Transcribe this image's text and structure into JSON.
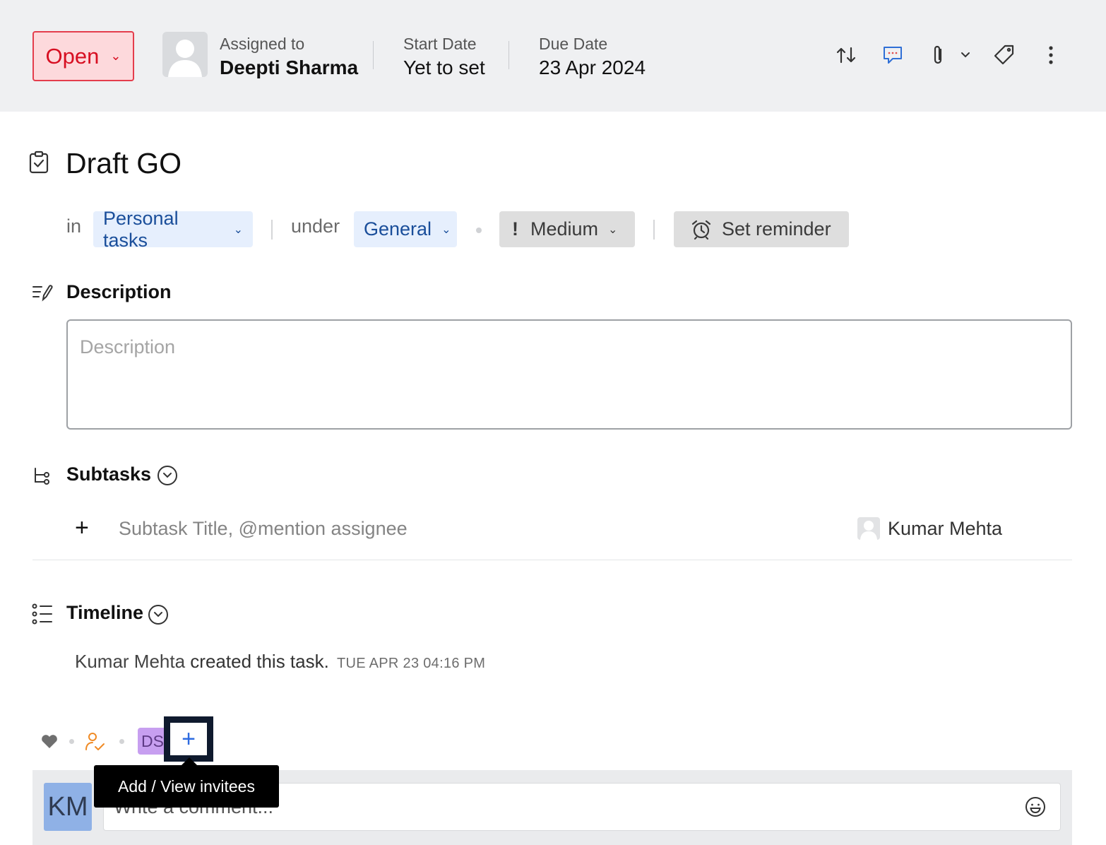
{
  "header": {
    "status_label": "Open",
    "assigned_label": "Assigned to",
    "assigned_name": "Deepti Sharma",
    "start_label": "Start Date",
    "start_value": "Yet to set",
    "due_label": "Due Date",
    "due_value": "23 Apr 2024",
    "icons": [
      "switch-icon",
      "comment-icon",
      "attachment-icon",
      "chevron-down-icon",
      "tag-icon",
      "more-icon"
    ],
    "colors": {
      "status_bg": "#fdd9dc",
      "status_border": "#e43d4c",
      "status_text": "#d70f22",
      "header_bg": "#eff0f2"
    }
  },
  "task": {
    "title": "Draft GO",
    "in_label": "in",
    "list": "Personal tasks",
    "under_label": "under",
    "section": "General",
    "priority_mark": "!",
    "priority": "Medium",
    "reminder": "Set reminder"
  },
  "description": {
    "heading": "Description",
    "placeholder": "Description"
  },
  "subtasks": {
    "heading": "Subtasks",
    "add_symbol": "+",
    "placeholder": "Subtask Title, @mention assignee",
    "assignee": "Kumar Mehta"
  },
  "timeline": {
    "heading": "Timeline",
    "entries": [
      {
        "actor": "Kumar Mehta",
        "action": " created this task.",
        "time": "TUE APR 23 04:16 PM"
      }
    ]
  },
  "footer": {
    "invitee_initials": "DS",
    "add_symbol": "+",
    "tooltip": "Add / View invitees",
    "user_initials": "KM",
    "comment_placeholder": "Write a comment..."
  }
}
